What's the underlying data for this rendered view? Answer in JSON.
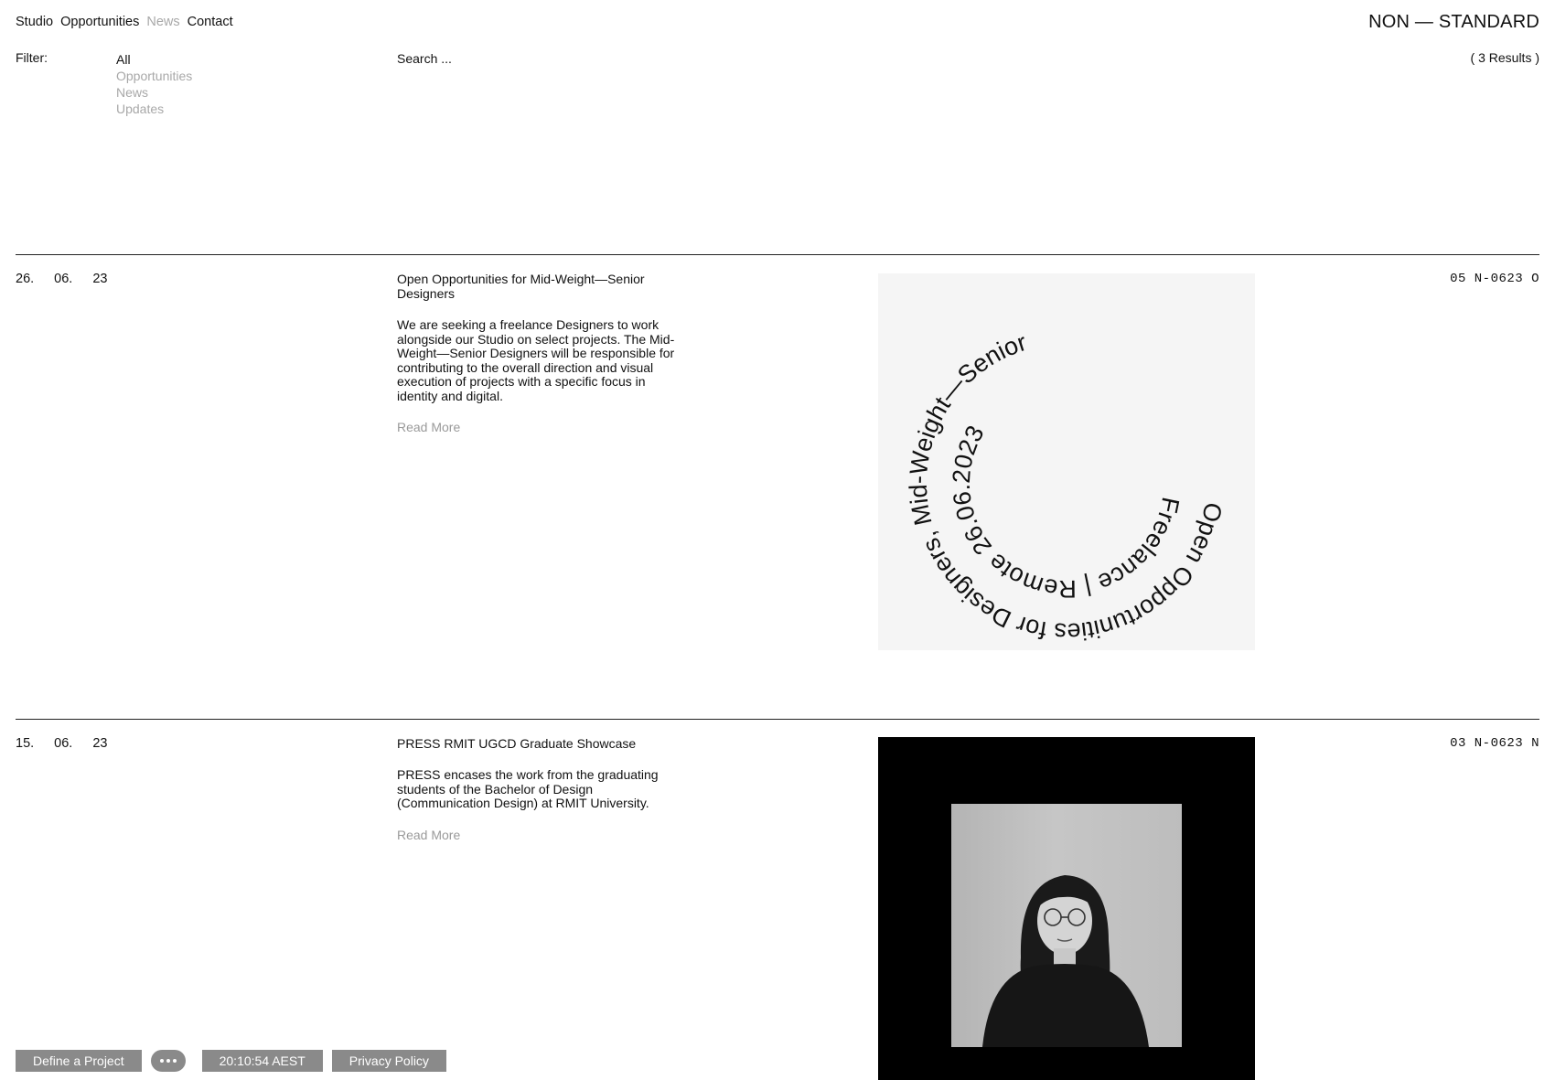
{
  "nav": {
    "items": [
      {
        "label": "Studio"
      },
      {
        "label": "Opportunities"
      },
      {
        "label": "News"
      },
      {
        "label": "Contact"
      }
    ]
  },
  "brand": "NON — STANDARD",
  "filter": {
    "label": "Filter:",
    "options": [
      "All",
      "Opportunities",
      "News",
      "Updates"
    ],
    "active": "All"
  },
  "search": {
    "placeholder": "Search ..."
  },
  "results": "( 3 Results )",
  "entries": [
    {
      "date": [
        "26.",
        "06.",
        "23"
      ],
      "title": "Open Opportunities for Mid-Weight—Senior Designers",
      "body": "We are seeking a freelance Designers to work alongside our Studio on select projects. The Mid-Weight—Senior Designers will be responsible for contributing to the overall direction and visual execution of projects with a specific focus in identity and digital.",
      "read_more": "Read More",
      "code": "05 N-0623 O",
      "graphic": {
        "outer_text": "Open Opportunities for Designers, Mid-Weight—Senior",
        "inner_text": "Freelance | Remote 26.06.2023"
      }
    },
    {
      "date": [
        "15.",
        "06.",
        "23"
      ],
      "title": "PRESS RMIT UGCD Graduate Showcase",
      "body": "PRESS encases the work from the graduating students of the Bachelor of Design (Communication Design) at RMIT University.",
      "read_more": "Read More",
      "code": "03 N-0623 N"
    }
  ],
  "footer": {
    "define": "Define a Project",
    "more_icon": "ellipsis-icon",
    "clock": "20:10:54 AEST",
    "privacy": "Privacy Policy"
  }
}
